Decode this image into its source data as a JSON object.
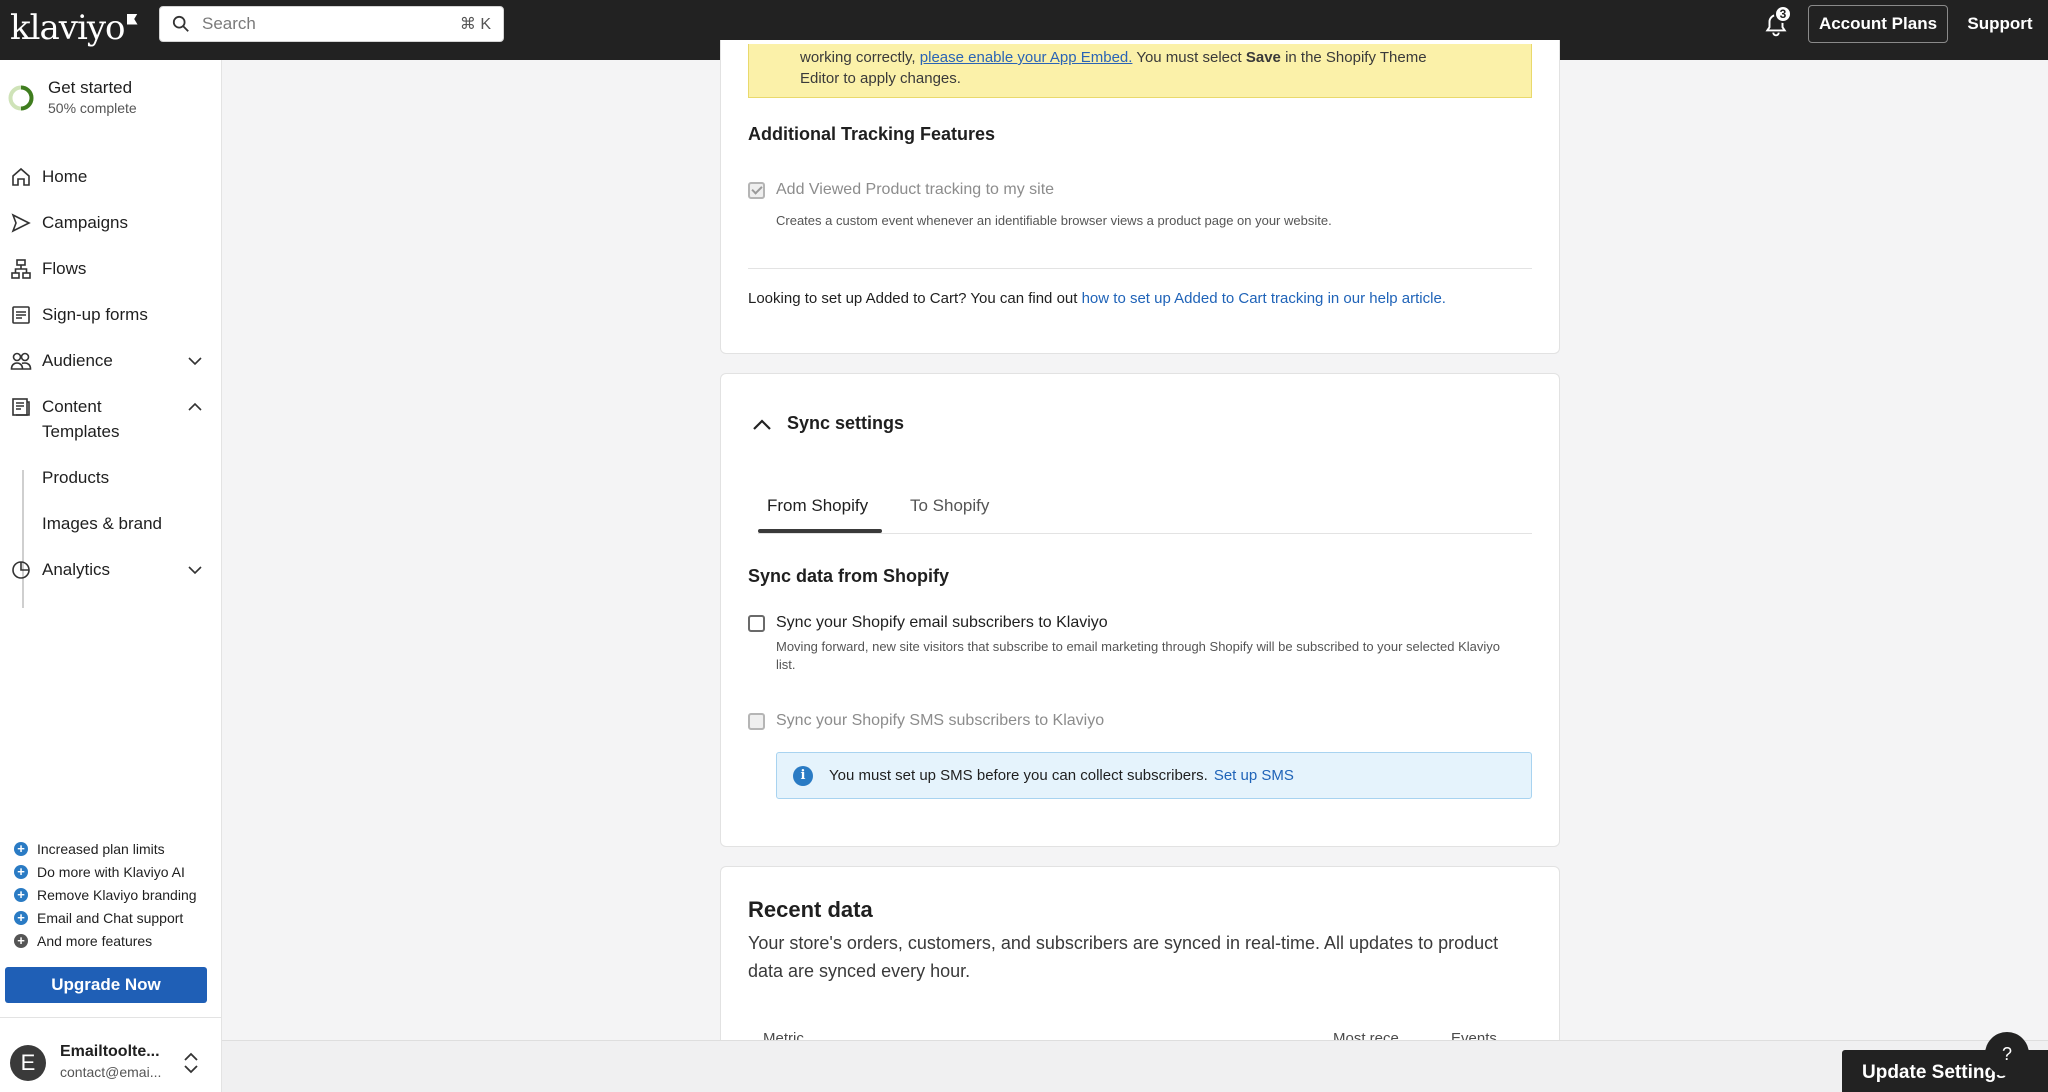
{
  "topbar": {
    "logo_text": "klaviyo",
    "search_placeholder": "Search",
    "search_shortcut": "⌘ K",
    "notification_count": "3",
    "account_plans_label": "Account Plans",
    "support_label": "Support"
  },
  "sidebar": {
    "get_started": {
      "title": "Get started",
      "progress": "50% complete",
      "progress_fraction": 0.5
    },
    "nav": [
      {
        "label": "Home",
        "icon": "home-icon"
      },
      {
        "label": "Campaigns",
        "icon": "send-icon"
      },
      {
        "label": "Flows",
        "icon": "flows-icon"
      },
      {
        "label": "Sign-up forms",
        "icon": "form-icon"
      },
      {
        "label": "Audience",
        "icon": "audience-icon",
        "expanded": false
      },
      {
        "label": "Content",
        "icon": "content-icon",
        "expanded": true
      },
      {
        "label": "Analytics",
        "icon": "analytics-icon",
        "expanded": false
      }
    ],
    "content_sub": [
      "Templates",
      "Products",
      "Images & brand"
    ],
    "perks": [
      "Increased plan limits",
      "Do more with Klaviyo AI",
      "Remove Klaviyo branding",
      "Email and Chat support",
      "And more features"
    ],
    "upgrade_label": "Upgrade Now",
    "account": {
      "initial": "E",
      "name": "Emailtoolte...",
      "email": "contact@emai..."
    }
  },
  "main": {
    "warning": {
      "line1_prefix": "working correctly,",
      "line1_link": "please enable your App Embed.",
      "line1_suffix": "You must select",
      "line1_bold": "Save",
      "line1_end": "in the Shopify Theme",
      "line2": "Editor to apply changes."
    },
    "tracking": {
      "title": "Additional Tracking Features",
      "checkbox_label": "Add Viewed Product tracking to my site",
      "checkbox_help": "Creates a custom event whenever an identifiable browser views a product page on your website.",
      "added_to_cart_text": "Looking to set up Added to Cart? You can find out",
      "added_to_cart_link": "how to set up Added to Cart tracking in our help article."
    },
    "sync": {
      "title": "Sync settings",
      "tabs": [
        "From Shopify",
        "To Shopify"
      ],
      "section_title": "Sync data from Shopify",
      "email_label": "Sync your Shopify email subscribers to Klaviyo",
      "email_help": "Moving forward, new site visitors that subscribe to email marketing through Shopify will be subscribed to your selected Klaviyo list.",
      "sms_label": "Sync your Shopify SMS subscribers to Klaviyo",
      "info_text": "You must set up SMS before you can collect subscribers.",
      "info_link": "Set up SMS"
    },
    "recent": {
      "title": "Recent data",
      "description": "Your store's orders, customers, and subscribers are synced in real-time. All updates to product data are synced every hour.",
      "columns": [
        "Metric",
        "Most rece...",
        "Events"
      ]
    },
    "update_button": "Update Settings",
    "help_fab": "?"
  }
}
